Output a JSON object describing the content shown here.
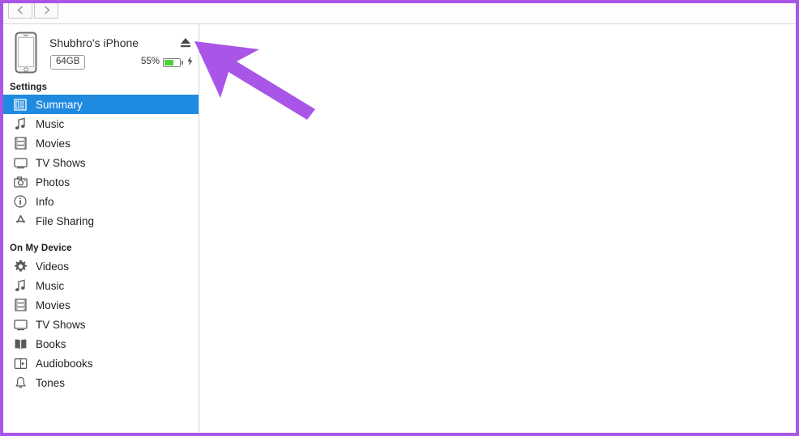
{
  "window": {
    "accent_purple": "#a855e8",
    "selection_blue": "#1e8ae0",
    "battery_green": "#4cd338"
  },
  "topbar": {
    "back_label": "‹",
    "forward_label": "›",
    "back_icon": "chevron-left-icon",
    "forward_icon": "chevron-right-icon"
  },
  "device": {
    "name": "Shubhro's iPhone",
    "capacity": "64GB",
    "battery_percent_label": "55%",
    "battery_percent_value": 55,
    "charging_icon": "lightning-bolt-icon",
    "eject_icon": "eject-icon",
    "thumb_icon": "iphone-icon"
  },
  "sidebar": {
    "settings_section": {
      "title": "Settings",
      "items": [
        {
          "label": "Summary",
          "icon": "summary-list-icon",
          "selected": true
        },
        {
          "label": "Music",
          "icon": "music-note-icon",
          "selected": false
        },
        {
          "label": "Movies",
          "icon": "film-strip-icon",
          "selected": false
        },
        {
          "label": "TV Shows",
          "icon": "tv-monitor-icon",
          "selected": false
        },
        {
          "label": "Photos",
          "icon": "camera-icon",
          "selected": false
        },
        {
          "label": "Info",
          "icon": "info-circle-icon",
          "selected": false
        },
        {
          "label": "File Sharing",
          "icon": "file-sharing-icon",
          "selected": false
        }
      ]
    },
    "device_section": {
      "title": "On My Device",
      "items": [
        {
          "label": "Videos",
          "icon": "gear-icon",
          "selected": false
        },
        {
          "label": "Music",
          "icon": "music-note-icon",
          "selected": false
        },
        {
          "label": "Movies",
          "icon": "film-strip-icon",
          "selected": false
        },
        {
          "label": "TV Shows",
          "icon": "tv-monitor-icon",
          "selected": false
        },
        {
          "label": "Books",
          "icon": "open-book-icon",
          "selected": false
        },
        {
          "label": "Audiobooks",
          "icon": "audiobook-icon",
          "selected": false
        },
        {
          "label": "Tones",
          "icon": "bell-icon",
          "selected": false
        }
      ]
    }
  },
  "annotation": {
    "arrow_icon": "pointer-arrow-annotation",
    "color": "#a855e8"
  }
}
